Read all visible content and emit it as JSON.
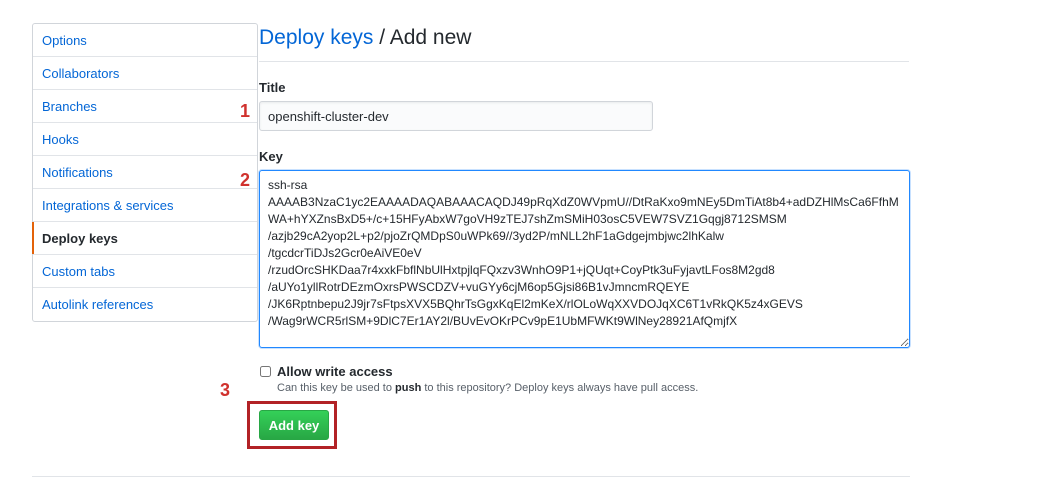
{
  "sidebar": {
    "items": [
      {
        "label": "Options",
        "selected": false
      },
      {
        "label": "Collaborators",
        "selected": false
      },
      {
        "label": "Branches",
        "selected": false
      },
      {
        "label": "Hooks",
        "selected": false
      },
      {
        "label": "Notifications",
        "selected": false
      },
      {
        "label": "Integrations & services",
        "selected": false
      },
      {
        "label": "Deploy keys",
        "selected": true
      },
      {
        "label": "Custom tabs",
        "selected": false
      },
      {
        "label": "Autolink references",
        "selected": false
      }
    ]
  },
  "header": {
    "title_link": "Deploy keys",
    "title_rest": " / Add new"
  },
  "form": {
    "title_label": "Title",
    "title_value": "openshift-cluster-dev",
    "key_label": "Key",
    "key_value": "ssh-rsa\nAAAAB3NzaC1yc2EAAAADAQABAAACAQDJ49pRqXdZ0WVpmU//DtRaKxo9mNEy5DmTiAt8b4+adDZHlMsCa6FfhMWA+hYXZnsBxD5+/c+15HFyAbxW7goVH9zTEJ7shZmSMiH03osC5VEW7SVZ1Gqgj8712SMSM\n/azjb29cA2yop2L+p2/pjoZrQMDpS0uWPk69//3yd2P/mNLL2hF1aGdgejmbjwc2lhKalw\n/tgcdcrTiDJs2Gcr0eAiVE0eV\n/rzudOrcSHKDaa7r4xxkFbflNbUlHxtpjlqFQxzv3WnhO9P1+jQUqt+CoyPtk3uFyjavtLFos8M2gd8\n/aUYo1yllRotrDEzmOxrsPWSCDZV+vuGYy6cjM6op5Gjsi86B1vJmncmRQEYE\n/JK6Rptnbepu2J9jr7sFtpsXVX5BQhrTsGgxKqEl2mKeX/rlOLoWqXXVDOJqXC6T1vRkQK5z4xGEVS\n/Wag9rWCR5rlSM+9DlC7Er1AY2l/BUvEvOKrPCv9pE1UbMFWKt9WlNey28921AfQmjfX",
    "allow_write_label": "Allow write access",
    "allow_write_checked": false,
    "note_before": "Can this key be used to ",
    "note_bold": "push",
    "note_after": " to this repository? Deploy keys always have pull access.",
    "submit_label": "Add key"
  },
  "annotations": {
    "step1": "1",
    "step2": "2",
    "step3": "3",
    "color": "#d0312d"
  },
  "colors": {
    "link": "#0366d6",
    "selected_accent": "#e36209",
    "button_green": "#28a745",
    "highlight_red": "#b22226"
  }
}
